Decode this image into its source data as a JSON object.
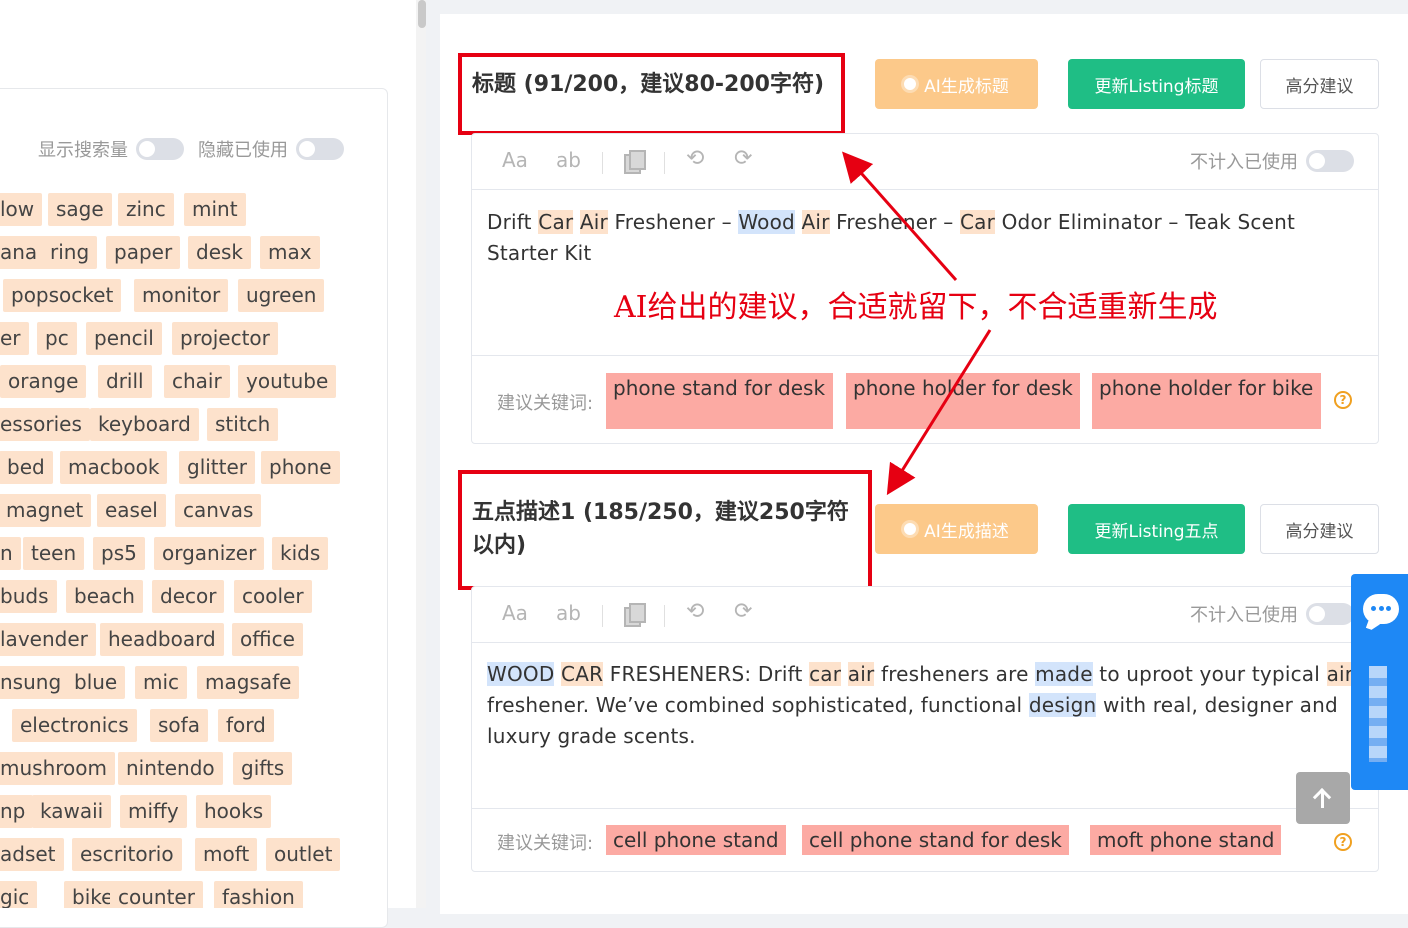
{
  "left": {
    "show_volume_label": "显示搜索量",
    "hide_used_label": "隐藏已使用",
    "tag_rows": [
      [
        "low",
        "sage",
        "zinc",
        "mint"
      ],
      [
        "ana",
        "ring",
        "paper",
        "desk",
        "max"
      ],
      [
        "popsocket",
        "monitor",
        "ugreen"
      ],
      [
        "er",
        "pc",
        "pencil",
        "projector"
      ],
      [
        "orange",
        "drill",
        "chair",
        "youtube"
      ],
      [
        "essories",
        "keyboard",
        "stitch"
      ],
      [
        "bed",
        "macbook",
        "glitter",
        "phone"
      ],
      [
        "magnet",
        "easel",
        "canvas"
      ],
      [
        "n",
        "teen",
        "ps5",
        "organizer",
        "kids"
      ],
      [
        "buds",
        "beach",
        "decor",
        "cooler"
      ],
      [
        "lavender",
        "headboard",
        "office"
      ],
      [
        "nsung",
        "blue",
        "mic",
        "magsafe"
      ],
      [
        "",
        "electronics",
        "sofa",
        "ford"
      ],
      [
        "mushroom",
        "nintendo",
        "gifts"
      ],
      [
        "np",
        "kawaii",
        "miffy",
        "hooks"
      ],
      [
        "adset",
        "escritorio",
        "moft",
        "outlet"
      ],
      [
        "gic",
        "bike",
        "counter",
        "fashion"
      ]
    ]
  },
  "title_section": {
    "heading": "标题 (91/200，建议80-200字符)",
    "ai_button": "AI生成标题",
    "update_button": "更新Listing标题",
    "score_button": "高分建议",
    "toolbar": {
      "aa": "Aa",
      "ab": "ab",
      "not_count_label": "不计入已使用"
    },
    "text_segments": [
      {
        "t": "Drift ",
        "h": ""
      },
      {
        "t": "Car",
        "h": "o"
      },
      {
        "t": " ",
        "h": ""
      },
      {
        "t": "Air",
        "h": "o"
      },
      {
        "t": " Freshener – ",
        "h": ""
      },
      {
        "t": "Wood",
        "h": "b"
      },
      {
        "t": " ",
        "h": ""
      },
      {
        "t": "Air",
        "h": "o"
      },
      {
        "t": " Freshener – ",
        "h": ""
      },
      {
        "t": "Car",
        "h": "o"
      },
      {
        "t": " Odor Eliminator – Teak Scent Starter Kit",
        "h": ""
      }
    ],
    "suggest_label": "建议关键词:",
    "suggest_keywords": [
      "phone stand for desk",
      "phone holder for desk",
      "phone holder for bike"
    ]
  },
  "annotation": "AI给出的建议，合适就留下，不合适重新生成",
  "bullet_section": {
    "heading": "五点描述1 (185/250，建议250字符以内)",
    "ai_button": "AI生成描述",
    "update_button": "更新Listing五点",
    "score_button": "高分建议",
    "toolbar": {
      "aa": "Aa",
      "ab": "ab",
      "not_count_label": "不计入已使用"
    },
    "text_segments": [
      {
        "t": "WOOD",
        "h": "b"
      },
      {
        "t": " ",
        "h": ""
      },
      {
        "t": "CAR",
        "h": "o"
      },
      {
        "t": " FRESHENERS: Drift ",
        "h": ""
      },
      {
        "t": "car",
        "h": "o"
      },
      {
        "t": " ",
        "h": ""
      },
      {
        "t": "air",
        "h": "o"
      },
      {
        "t": " fresheners are ",
        "h": ""
      },
      {
        "t": "made",
        "h": "b"
      },
      {
        "t": " to uproot your typical ",
        "h": ""
      },
      {
        "t": "air",
        "h": "o"
      },
      {
        "t": " freshener. We’ve combined sophisticated, functional ",
        "h": ""
      },
      {
        "t": "design",
        "h": "b"
      },
      {
        "t": " with real, designer and luxury grade scents.",
        "h": ""
      }
    ],
    "suggest_label": "建议关键词:",
    "suggest_keywords": [
      "cell phone stand",
      "cell phone stand for desk",
      "moft phone stand"
    ]
  },
  "help_glyph": "?",
  "colors": {
    "tag_bg": "#fde2cc",
    "ai_button": "#fcc98a",
    "green_button": "#1fbe85",
    "suggest_tag": "#fcaaa3",
    "annotation_red": "#e60012",
    "chat_blue": "#1e88f5"
  },
  "icons": [
    "copy-icon",
    "undo-icon",
    "redo-icon",
    "bulb-icon",
    "help-icon",
    "chat-icon",
    "back-to-top-icon"
  ]
}
